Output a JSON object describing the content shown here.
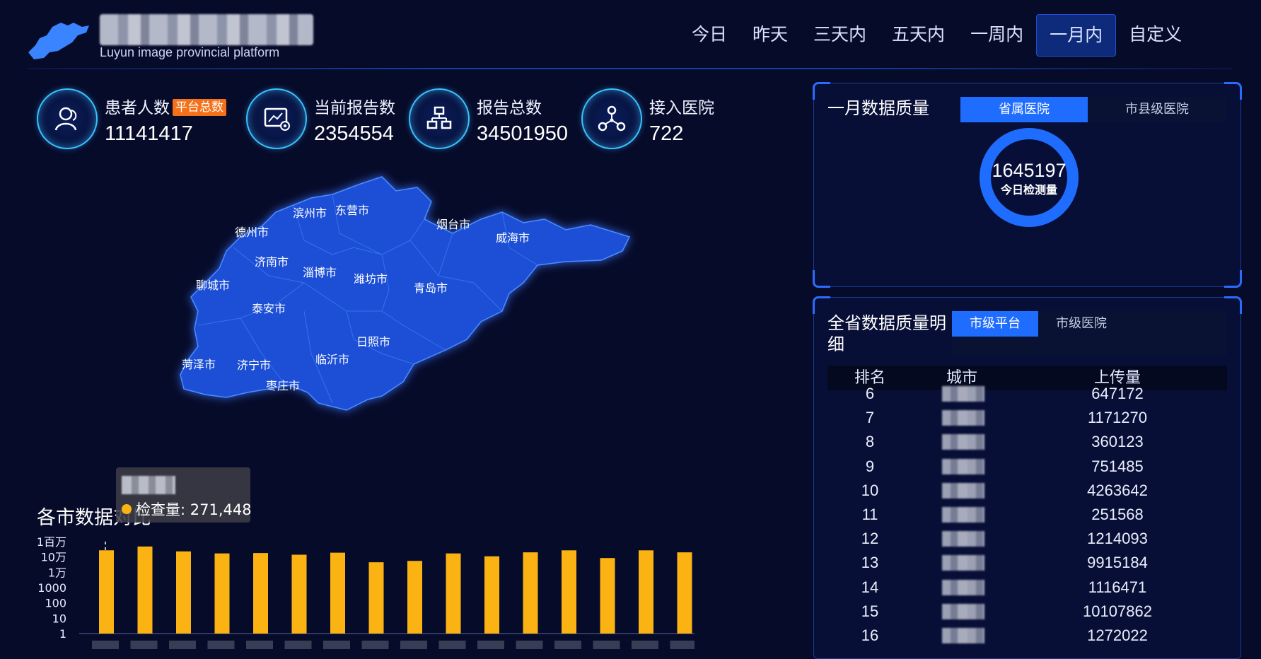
{
  "header": {
    "subtitle": "Luyun image provincial platform",
    "range_tabs": [
      {
        "label": "今日",
        "active": false
      },
      {
        "label": "昨天",
        "active": false
      },
      {
        "label": "三天内",
        "active": false
      },
      {
        "label": "五天内",
        "active": false
      },
      {
        "label": "一周内",
        "active": false
      },
      {
        "label": "一月内",
        "active": true
      },
      {
        "label": "自定义",
        "active": false
      }
    ]
  },
  "stats": [
    {
      "label": "患者人数",
      "badge": "平台总数",
      "value": "11141417",
      "icon": "patients-icon"
    },
    {
      "label": "当前报告数",
      "value": "2354554",
      "icon": "monitor-report-icon"
    },
    {
      "label": "报告总数",
      "value": "34501950",
      "icon": "hierarchy-icon"
    },
    {
      "label": "接入医院",
      "value": "722",
      "icon": "network-nodes-icon"
    }
  ],
  "map": {
    "cities": [
      "滨州市",
      "东营市",
      "德州市",
      "烟台市",
      "威海市",
      "济南市",
      "淄博市",
      "潍坊市",
      "聊城市",
      "青岛市",
      "泰安市",
      "日照市",
      "菏泽市",
      "济宁市",
      "临沂市",
      "枣庄市"
    ]
  },
  "comparison": {
    "title": "各市数据对比",
    "tooltip_value": "检查量: 271,448"
  },
  "chart_data": {
    "type": "bar",
    "title": "各市数据对比",
    "y_scale": "log",
    "y_ticks": [
      "1",
      "10",
      "100",
      "1000",
      "1万",
      "10万",
      "1百万"
    ],
    "values": [
      271448,
      480000,
      230000,
      170000,
      180000,
      140000,
      190000,
      45000,
      55000,
      170000,
      110000,
      200000,
      270000,
      85000,
      270000,
      200000
    ],
    "bar_color": "#fbb313"
  },
  "quality_panel": {
    "title": "一月数据质量",
    "tabs": [
      {
        "label": "省属医院",
        "active": true
      },
      {
        "label": "市县级医院",
        "active": false
      }
    ],
    "donut_value": "1645197",
    "donut_label": "今日检测量"
  },
  "detail_panel": {
    "title": "全省数据质量明细",
    "tabs": [
      {
        "label": "市级平台",
        "active": true
      },
      {
        "label": "市级医院",
        "active": false
      }
    ],
    "columns": [
      "排名",
      "城市",
      "上传量"
    ],
    "rows": [
      {
        "rank": "6",
        "value": "647172"
      },
      {
        "rank": "7",
        "value": "1171270"
      },
      {
        "rank": "8",
        "value": "360123"
      },
      {
        "rank": "9",
        "value": "751485"
      },
      {
        "rank": "10",
        "value": "4263642"
      },
      {
        "rank": "11",
        "value": "251568"
      },
      {
        "rank": "12",
        "value": "1214093"
      },
      {
        "rank": "13",
        "value": "9915184"
      },
      {
        "rank": "14",
        "value": "1116471"
      },
      {
        "rank": "15",
        "value": "10107862"
      },
      {
        "rank": "16",
        "value": "1272022"
      }
    ]
  },
  "colors": {
    "background": "#070b2a",
    "accent": "#1f6dff",
    "badge": "#f4711a",
    "bar": "#fbb313",
    "map_fill": "#1a4fd6"
  }
}
